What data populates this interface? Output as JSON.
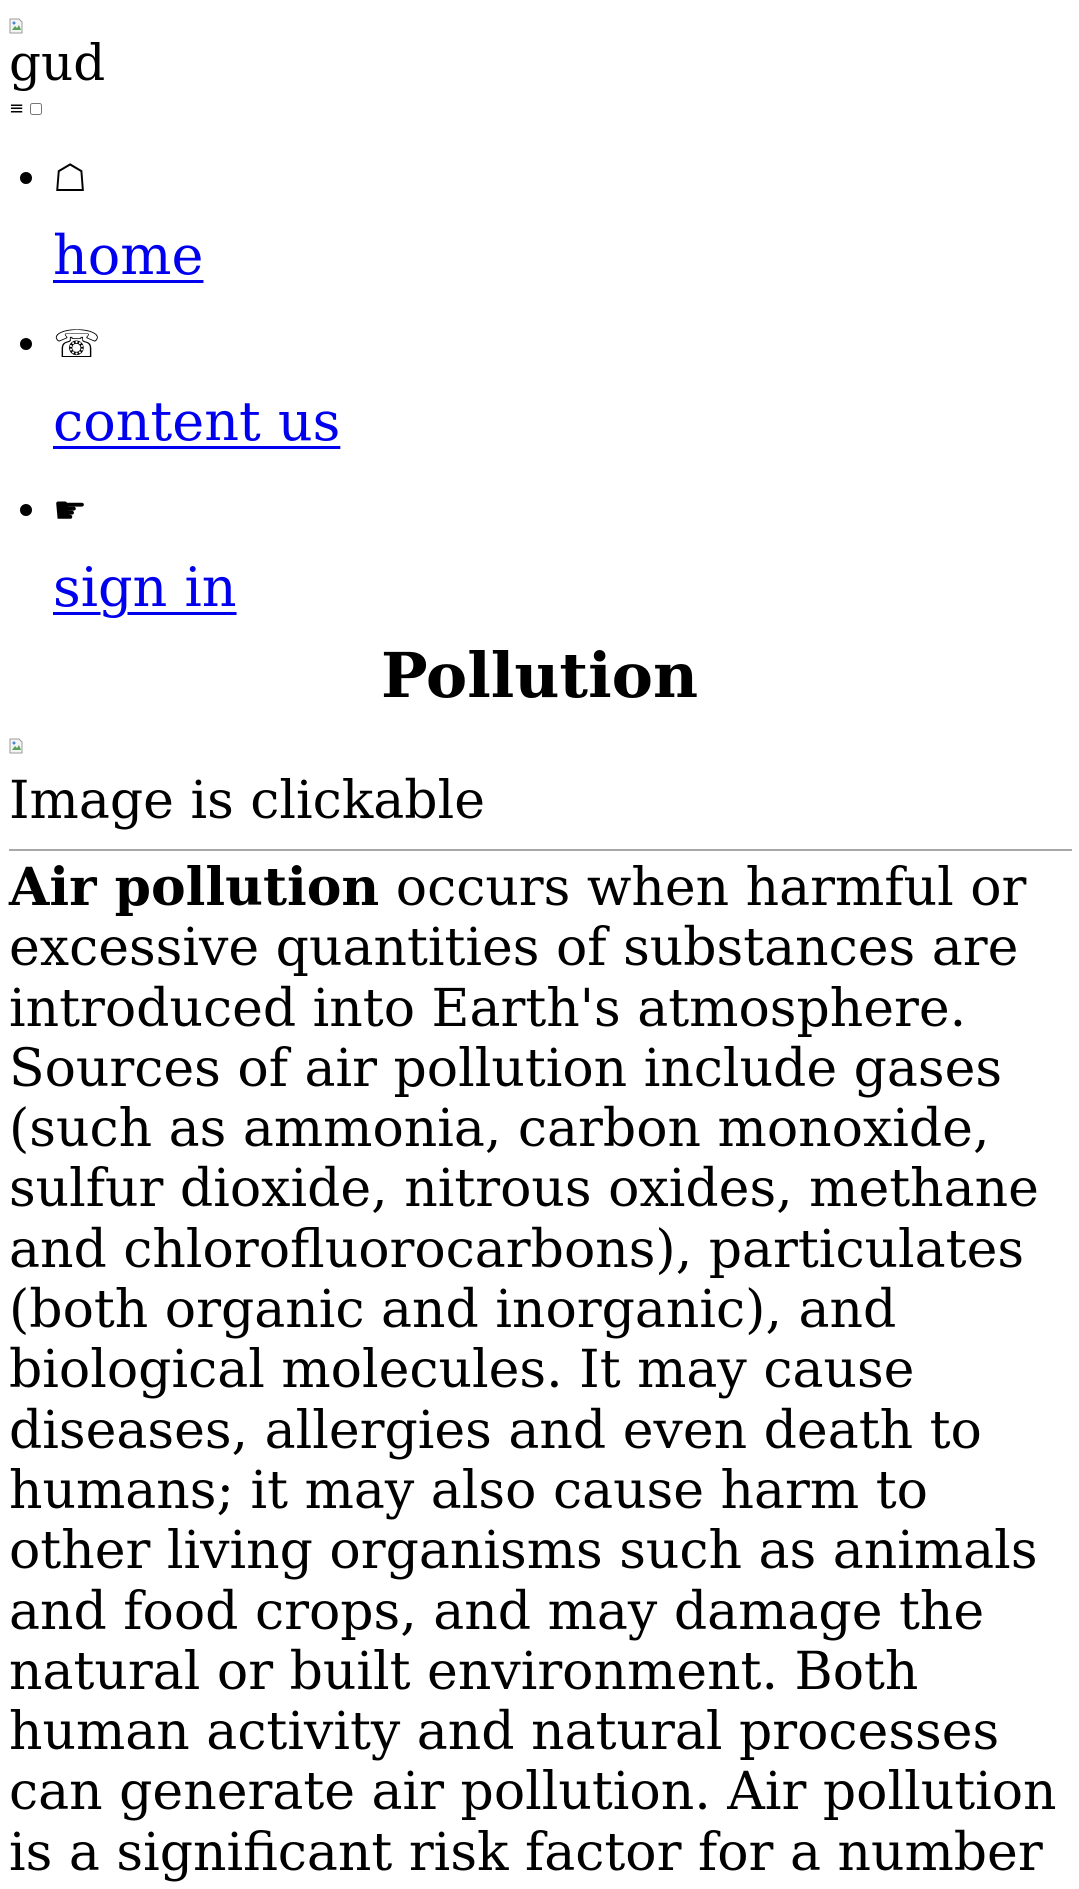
{
  "header": {
    "site_name": "gud",
    "menu_icon": "hamburger-icon",
    "menu_glyph": "≡"
  },
  "nav": {
    "items": [
      {
        "icon": "house-icon",
        "glyph": "☖",
        "label": "home"
      },
      {
        "icon": "telephone-icon",
        "glyph": "☏",
        "label": "content us"
      },
      {
        "icon": "pointing-hand-icon",
        "glyph": "☛",
        "label": "sign in"
      }
    ]
  },
  "main": {
    "title": "Pollution",
    "image_caption": "Image is clickable",
    "article": {
      "lead_bold": "Air pollution",
      "body": " occurs when harmful or excessive quantities of substances are introduced into Earth's atmosphere. Sources of air pollution include gases (such as ammonia, carbon monoxide, sulfur dioxide, nitrous oxides, methane and chlorofluorocarbons), particulates (both organic and inorganic), and biological molecules. It may cause diseases, allergies and even death to humans; it may also cause harm to other living organisms such as animals and food crops, and may damage the natural or built environment. Both human activity and natural processes can generate air pollution. Air pollution is a significant risk factor for a number of pollution-related diseases, including"
    }
  },
  "colors": {
    "link": "#0000ee",
    "text": "#000000",
    "divider": "#a8a8a8"
  }
}
